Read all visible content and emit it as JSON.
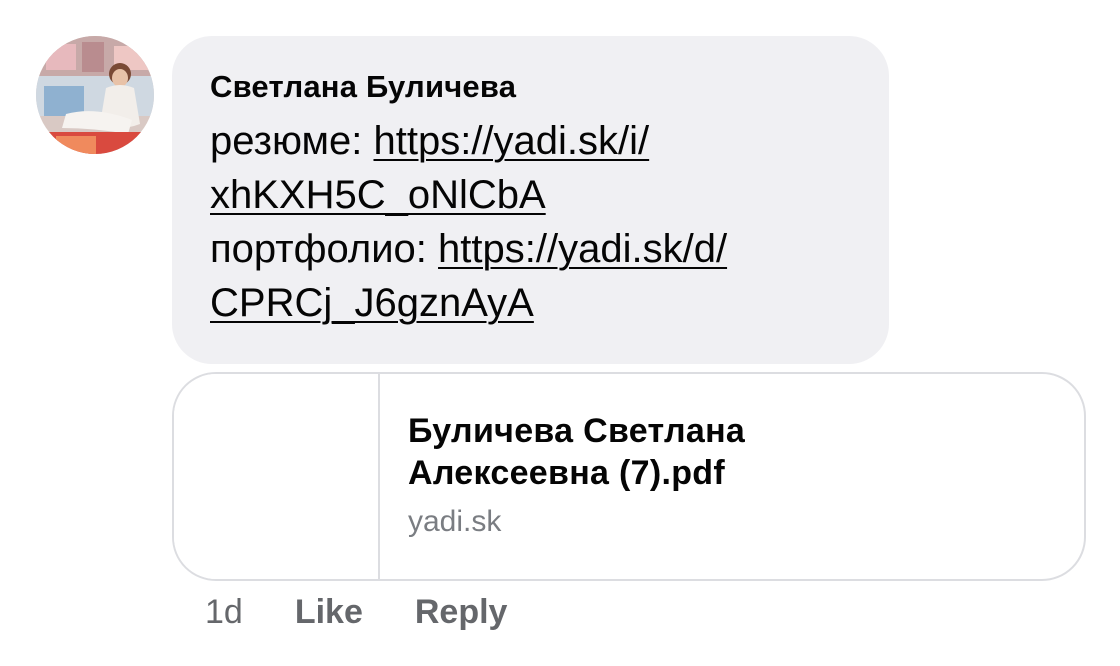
{
  "comment": {
    "author": "Светлана Буличева",
    "lines": [
      {
        "label": "резюме: ",
        "link_part1": "https://yadi.sk/i/",
        "link_part2": "xhKXH5C_oNlCbA"
      },
      {
        "label": "портфолио: ",
        "link_part1": "https://yadi.sk/d/",
        "link_part2": "CPRCj_J6gznAyA"
      }
    ]
  },
  "link_preview": {
    "title_line1": "Буличева Светлана",
    "title_line2": "Алексеевна (7).pdf",
    "domain": "yadi.sk"
  },
  "actions": {
    "timestamp": "1d",
    "like_label": "Like",
    "reply_label": "Reply"
  },
  "colors": {
    "bubble_bg": "#f0f0f3",
    "text": "#050505",
    "secondary_text": "#65676b",
    "border": "#dcdde1"
  }
}
